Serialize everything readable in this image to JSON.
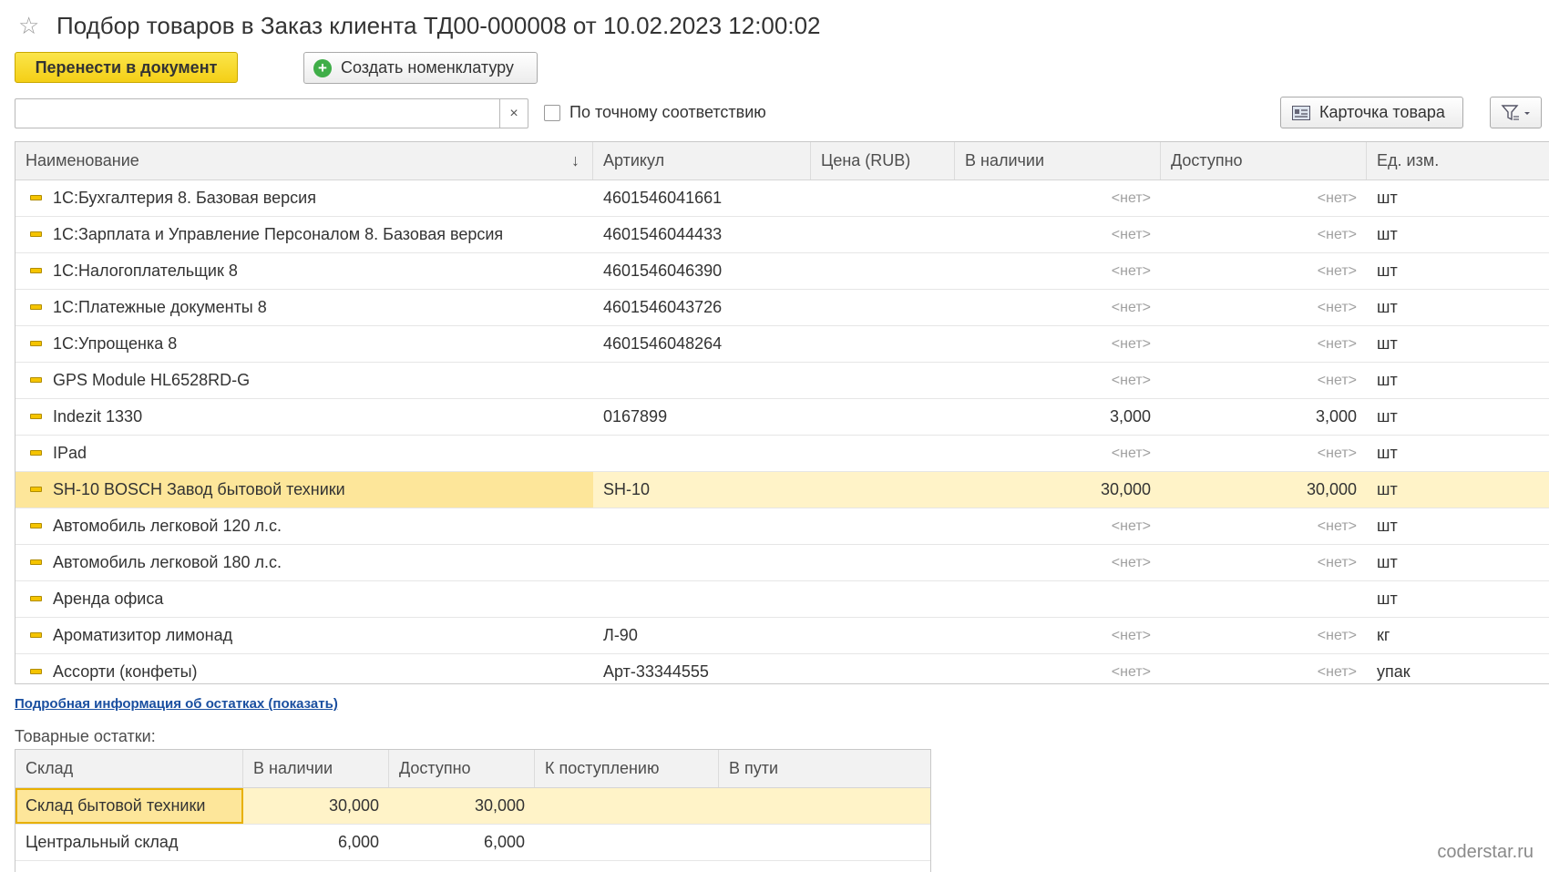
{
  "header": {
    "title": "Подбор товаров в Заказ клиента ТД00-000008 от 10.02.2023 12:00:02"
  },
  "toolbar": {
    "transfer_label": "Перенести в документ",
    "create_label": "Создать номенклатуру",
    "exact_match_label": "По точному соответствию",
    "card_label": "Карточка товара",
    "search_value": "",
    "clear_glyph": "×"
  },
  "grid": {
    "headers": {
      "name": "Наименование",
      "sort": "↓",
      "article": "Артикул",
      "price": "Цена (RUB)",
      "stock": "В наличии",
      "available": "Доступно",
      "unit": "Ед. изм."
    },
    "rows": [
      {
        "name": "1С:Бухгалтерия 8. Базовая версия",
        "article": "4601546041661",
        "price": "",
        "stock": "<нет>",
        "available": "<нет>",
        "unit": "шт"
      },
      {
        "name": "1С:Зарплата и Управление Персоналом 8. Базовая версия",
        "article": "4601546044433",
        "price": "",
        "stock": "<нет>",
        "available": "<нет>",
        "unit": "шт"
      },
      {
        "name": "1С:Налогоплательщик 8",
        "article": "4601546046390",
        "price": "",
        "stock": "<нет>",
        "available": "<нет>",
        "unit": "шт"
      },
      {
        "name": "1С:Платежные документы 8",
        "article": "4601546043726",
        "price": "",
        "stock": "<нет>",
        "available": "<нет>",
        "unit": "шт"
      },
      {
        "name": "1С:Упрощенка 8",
        "article": "4601546048264",
        "price": "",
        "stock": "<нет>",
        "available": "<нет>",
        "unit": "шт"
      },
      {
        "name": "GPS Module HL6528RD-G",
        "article": "",
        "price": "",
        "stock": "<нет>",
        "available": "<нет>",
        "unit": "шт"
      },
      {
        "name": "Indezit 1330",
        "article": "0167899",
        "price": "",
        "stock": "3,000",
        "available": "3,000",
        "unit": "шт"
      },
      {
        "name": "IPad",
        "article": "",
        "price": "",
        "stock": "<нет>",
        "available": "<нет>",
        "unit": "шт"
      },
      {
        "name": "SH-10 BOSCH Завод бытовой техники",
        "article": "SH-10",
        "price": "",
        "stock": "30,000",
        "available": "30,000",
        "unit": "шт"
      },
      {
        "name": "Автомобиль легковой 120 л.с.",
        "article": "",
        "price": "",
        "stock": "<нет>",
        "available": "<нет>",
        "unit": "шт"
      },
      {
        "name": "Автомобиль легковой 180 л.с.",
        "article": "",
        "price": "",
        "stock": "<нет>",
        "available": "<нет>",
        "unit": "шт"
      },
      {
        "name": "Аренда офиса",
        "article": "",
        "price": "",
        "stock": "",
        "available": "",
        "unit": "шт"
      },
      {
        "name": "Ароматизитор лимонад",
        "article": "Л-90",
        "price": "",
        "stock": "<нет>",
        "available": "<нет>",
        "unit": "кг"
      },
      {
        "name": "Ассорти (конфеты)",
        "article": "Арт-33344555",
        "price": "",
        "stock": "<нет>",
        "available": "<нет>",
        "unit": "упак"
      }
    ]
  },
  "details_link": "Подробная информация об остатках (показать)",
  "stock": {
    "label": "Товарные остатки:",
    "headers": {
      "warehouse": "Склад",
      "in_stock": "В наличии",
      "available": "Доступно",
      "incoming": "К поступлению",
      "in_transit": "В пути"
    },
    "rows": [
      {
        "warehouse": "Склад бытовой техники",
        "in_stock": "30,000",
        "available": "30,000",
        "incoming": "",
        "in_transit": ""
      },
      {
        "warehouse": "Центральный склад",
        "in_stock": "6,000",
        "available": "6,000",
        "incoming": "",
        "in_transit": ""
      }
    ]
  },
  "watermark": "coderstar.ru",
  "colors": {
    "accent": "#f4cf16",
    "selection": "#fff3c8",
    "link": "#1a4fa0"
  },
  "icons": {
    "favorite": "star-icon",
    "create": "plus-circle-icon",
    "card": "product-card-icon",
    "filter": "filter-icon",
    "item": "item-icon"
  }
}
